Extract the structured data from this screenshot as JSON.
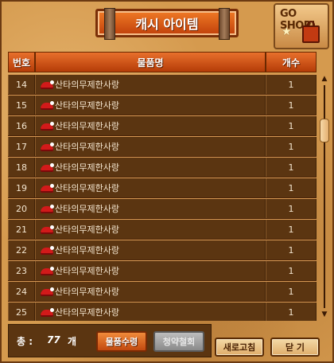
{
  "window": {
    "title": "캐시 아이템",
    "go_shop_label": "GO SHOP!"
  },
  "table": {
    "headers": {
      "number": "번호",
      "item_name": "물품명",
      "count": "개수"
    },
    "rows": [
      {
        "number": "14",
        "name": "산타의무제한사랑",
        "count": "1",
        "icon": "santa-hat-icon"
      },
      {
        "number": "15",
        "name": "산타의무제한사랑",
        "count": "1",
        "icon": "santa-hat-icon"
      },
      {
        "number": "16",
        "name": "산타의무제한사랑",
        "count": "1",
        "icon": "santa-hat-icon"
      },
      {
        "number": "17",
        "name": "산타의무제한사랑",
        "count": "1",
        "icon": "santa-hat-icon"
      },
      {
        "number": "18",
        "name": "산타의무제한사랑",
        "count": "1",
        "icon": "santa-hat-icon"
      },
      {
        "number": "19",
        "name": "산타의무제한사랑",
        "count": "1",
        "icon": "santa-hat-icon"
      },
      {
        "number": "20",
        "name": "산타의무제한사랑",
        "count": "1",
        "icon": "santa-hat-icon"
      },
      {
        "number": "21",
        "name": "산타의무제한사랑",
        "count": "1",
        "icon": "santa-hat-icon"
      },
      {
        "number": "22",
        "name": "산타의무제한사랑",
        "count": "1",
        "icon": "santa-hat-icon"
      },
      {
        "number": "23",
        "name": "산타의무제한사랑",
        "count": "1",
        "icon": "santa-hat-icon"
      },
      {
        "number": "24",
        "name": "산타의무제한사랑",
        "count": "1",
        "icon": "santa-hat-icon"
      },
      {
        "number": "25",
        "name": "산타의무제한사랑",
        "count": "1",
        "icon": "santa-hat-icon"
      }
    ]
  },
  "footer": {
    "total_label": "총 :",
    "total_value": "77",
    "total_unit": "개",
    "receive_button": "물품수령",
    "cancel_button": "청약철회"
  },
  "buttons": {
    "refresh": "새로고침",
    "close": "닫 기"
  },
  "colors": {
    "accent": "#e0642a",
    "row_background": "#5b3511",
    "window_background": "#d59a4e"
  }
}
